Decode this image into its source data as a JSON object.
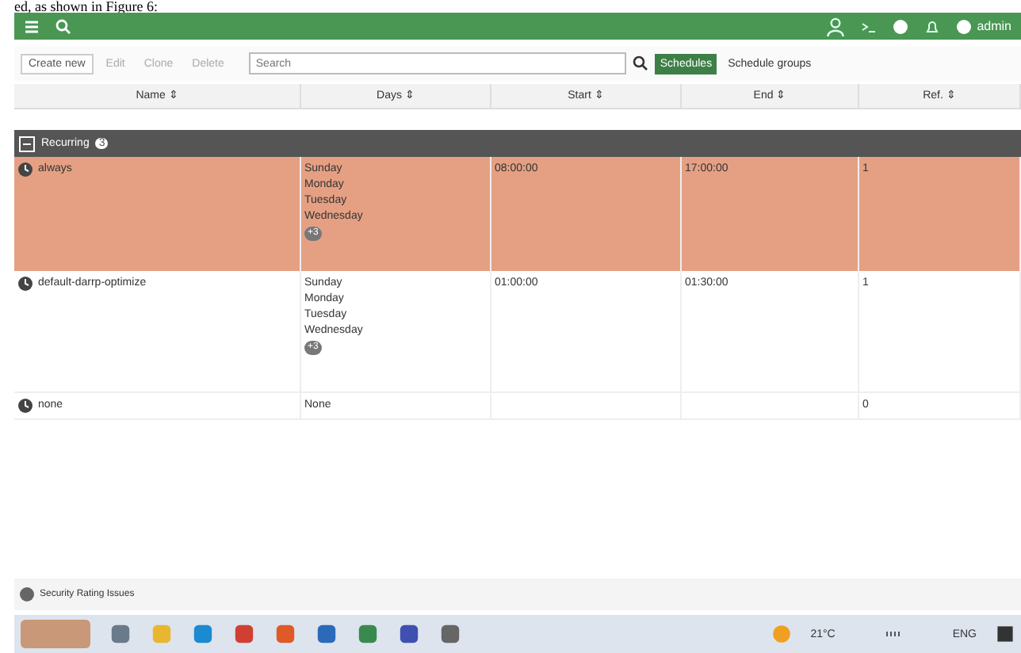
{
  "caption": "ed, as shown in Figure 6:",
  "header": {
    "user": "admin"
  },
  "toolbar": {
    "buttons": [
      {
        "label": "Create new",
        "disabled": false
      },
      {
        "label": "Edit",
        "disabled": true
      },
      {
        "label": "Clone",
        "disabled": true
      },
      {
        "label": "Delete",
        "disabled": true
      }
    ],
    "search": {
      "placeholder": "Search"
    }
  },
  "tabs": [
    {
      "label": "Schedules",
      "selected": true
    },
    {
      "label": "Schedule groups",
      "selected": false
    }
  ],
  "table": {
    "columns": [
      "Name ⇕",
      "Days ⇕",
      "Start ⇕",
      "End ⇕",
      "Ref. ⇕"
    ],
    "group": {
      "label": "Recurring",
      "count": "3"
    },
    "rows": [
      {
        "name": "always",
        "days": [
          "Sunday",
          "Monday",
          "Tuesday",
          "Wednesday"
        ],
        "more": "+3",
        "start": "08:00:00",
        "end": "17:00:00",
        "ref": "1",
        "selected": true
      },
      {
        "name": "default-darrp-optimize",
        "days": [
          "Sunday",
          "Monday",
          "Tuesday",
          "Wednesday"
        ],
        "more": "+3",
        "start": "01:00:00",
        "end": "01:30:00",
        "ref": "1",
        "selected": false
      },
      {
        "name": "none",
        "days": [
          "None"
        ],
        "start": "",
        "end": "",
        "ref": "0",
        "selected": false
      }
    ]
  },
  "footer": {
    "label": "Security Rating Issues"
  },
  "taskbar": {
    "weather": "21°C",
    "language": "ENG"
  }
}
